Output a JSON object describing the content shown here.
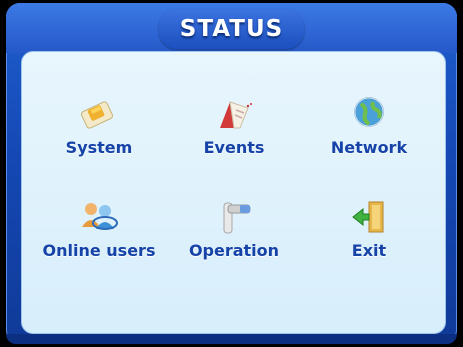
{
  "window": {
    "title": "STATUS"
  },
  "menu": {
    "items": [
      {
        "label": "System",
        "icon": "system-icon"
      },
      {
        "label": "Events",
        "icon": "events-icon"
      },
      {
        "label": "Network",
        "icon": "network-icon"
      },
      {
        "label": "Online users",
        "icon": "online-users-icon"
      },
      {
        "label": "Operation",
        "icon": "operation-icon"
      },
      {
        "label": "Exit",
        "icon": "exit-icon"
      }
    ]
  },
  "colors": {
    "frame_blue": "#1548b4",
    "panel_bg": "#e0f2fc",
    "label_blue": "#1543a8",
    "title_text": "#ffffff"
  }
}
